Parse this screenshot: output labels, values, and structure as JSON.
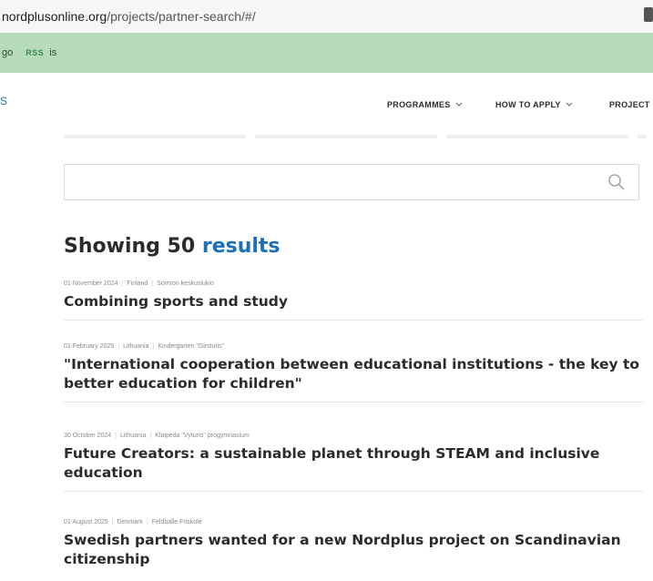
{
  "browser": {
    "url_host": "nordplusonline.org",
    "url_path": "/projects/partner-search/#/"
  },
  "bookmarks": {
    "item1": "go",
    "badge": "RSS",
    "item2": "is"
  },
  "site": {
    "logo_fragment": "S",
    "nav": {
      "programmes": "PROGRAMMES",
      "how_to_apply": "HOW TO APPLY",
      "projects": "PROJECT"
    }
  },
  "search": {
    "placeholder": ""
  },
  "results": {
    "heading_prefix": "Showing 50",
    "heading_accent": "results",
    "items": [
      {
        "date": "01 November 2024",
        "country": "Finland",
        "organisation": "Somron keskuslukio",
        "title": "Combining sports and study"
      },
      {
        "date": "01 February 2025",
        "country": "Lithuania",
        "organisation": "Kindergarten \"Girstutis\"",
        "title": "\"International cooperation between educational institutions - the key to better education for children\""
      },
      {
        "date": "30 October 2024",
        "country": "Lithuania",
        "organisation": "Klaipeda \"Vyturio\" progymnasium",
        "title": "Future Creators: a sustainable planet through STEAM and inclusive education"
      },
      {
        "date": "01 August 2025",
        "country": "Denmark",
        "organisation": "Feldballe Friskole",
        "title": "Swedish partners wanted for a new Nordplus project on Scandinavian citizenship"
      }
    ]
  }
}
